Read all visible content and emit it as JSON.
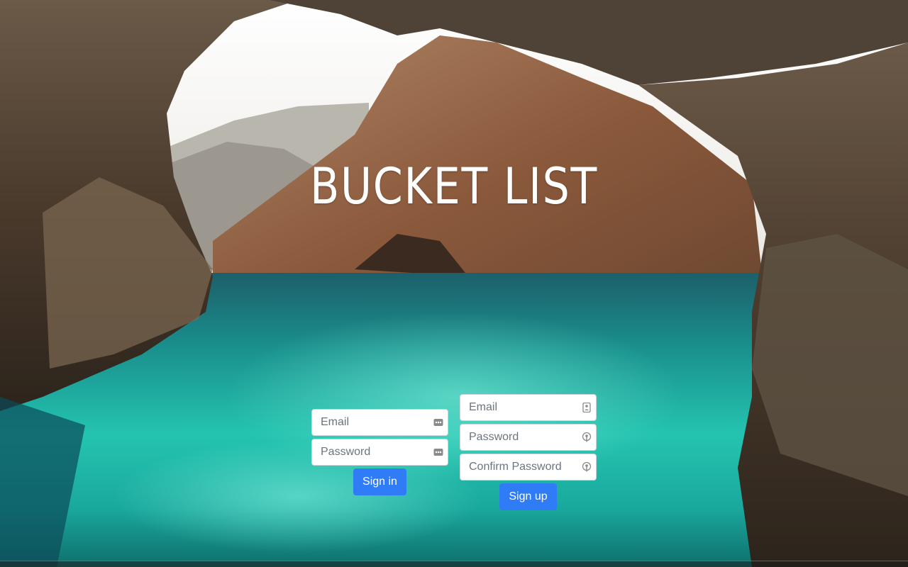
{
  "page": {
    "title": "BUCKET LIST"
  },
  "signin": {
    "email_placeholder": "Email",
    "password_placeholder": "Password",
    "submit_label": "Sign in",
    "field_icon": "ellipsis-key-icon"
  },
  "signup": {
    "email_placeholder": "Email",
    "password_placeholder": "Password",
    "confirm_placeholder": "Confirm Password",
    "submit_label": "Sign up",
    "email_icon": "contact-card-icon",
    "password_icon": "key-circle-icon"
  },
  "colors": {
    "button": "#2f7cf6",
    "water": "#1fb3a6",
    "rock": "#7b5a44"
  }
}
